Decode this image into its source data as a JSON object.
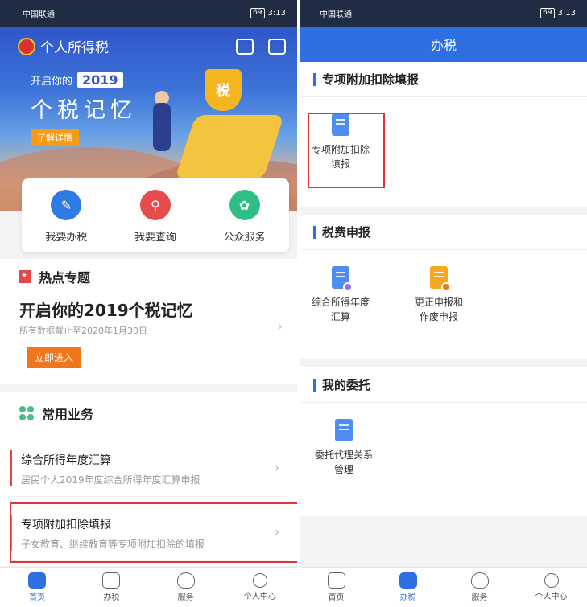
{
  "left": {
    "status": {
      "carrier": "中国联通",
      "battery": "69",
      "time": "3:13"
    },
    "app_title": "个人所得税",
    "banner": {
      "prefix": "开启你的",
      "year": "2019",
      "headline": "个税记忆",
      "button": "了解详情",
      "shield_text": "税"
    },
    "quick_actions": [
      {
        "label": "我要办税",
        "icon": "pencil-icon",
        "color": "#2f7be6"
      },
      {
        "label": "我要查询",
        "icon": "magnifier-icon",
        "color": "#e64c4c"
      },
      {
        "label": "公众服务",
        "icon": "flower-icon",
        "color": "#2fbf86"
      }
    ],
    "hot": {
      "title": "热点专题",
      "headline": "开启你的2019个税记忆",
      "sub": "所有数据截止至2020年1月30日",
      "button": "立即进入"
    },
    "common": {
      "title": "常用业务",
      "items": [
        {
          "title": "综合所得年度汇算",
          "sub": "居民个人2019年度综合所得年度汇算申报",
          "bar_color": "#e24848"
        },
        {
          "title": "专项附加扣除填报",
          "sub": "子女教育、继续教育等专项附加扣除的填报",
          "bar_color": "#3ec28a"
        }
      ]
    },
    "tabs": [
      {
        "label": "首页",
        "active": true
      },
      {
        "label": "办税",
        "active": false
      },
      {
        "label": "服务",
        "active": false
      },
      {
        "label": "个人中心",
        "active": false
      }
    ]
  },
  "right": {
    "status": {
      "carrier": "中国联通",
      "battery": "69",
      "time": "3:13"
    },
    "header": "办税",
    "sections": [
      {
        "title": "专项附加扣除填报",
        "items": [
          {
            "label": "专项附加扣除填报",
            "label1": "专项附加扣除",
            "label2": "填报",
            "icon_color": "#4f8ef0"
          }
        ]
      },
      {
        "title": "税费申报",
        "items": [
          {
            "label1": "综合所得年度",
            "label2": "汇算",
            "icon_color": "#4f8ef0",
            "badge_color": "#9c6cf0"
          },
          {
            "label1": "更正申报和",
            "label2": "作废申报",
            "icon_color": "#f5a623",
            "badge_color": "#f0751c"
          }
        ]
      },
      {
        "title": "我的委托",
        "items": [
          {
            "label1": "委托代理关系",
            "label2": "管理",
            "icon_color": "#4f8ef0"
          }
        ]
      }
    ],
    "tabs": [
      {
        "label": "首页",
        "active": false
      },
      {
        "label": "办税",
        "active": true
      },
      {
        "label": "服务",
        "active": false
      },
      {
        "label": "个人中心",
        "active": false
      }
    ]
  }
}
